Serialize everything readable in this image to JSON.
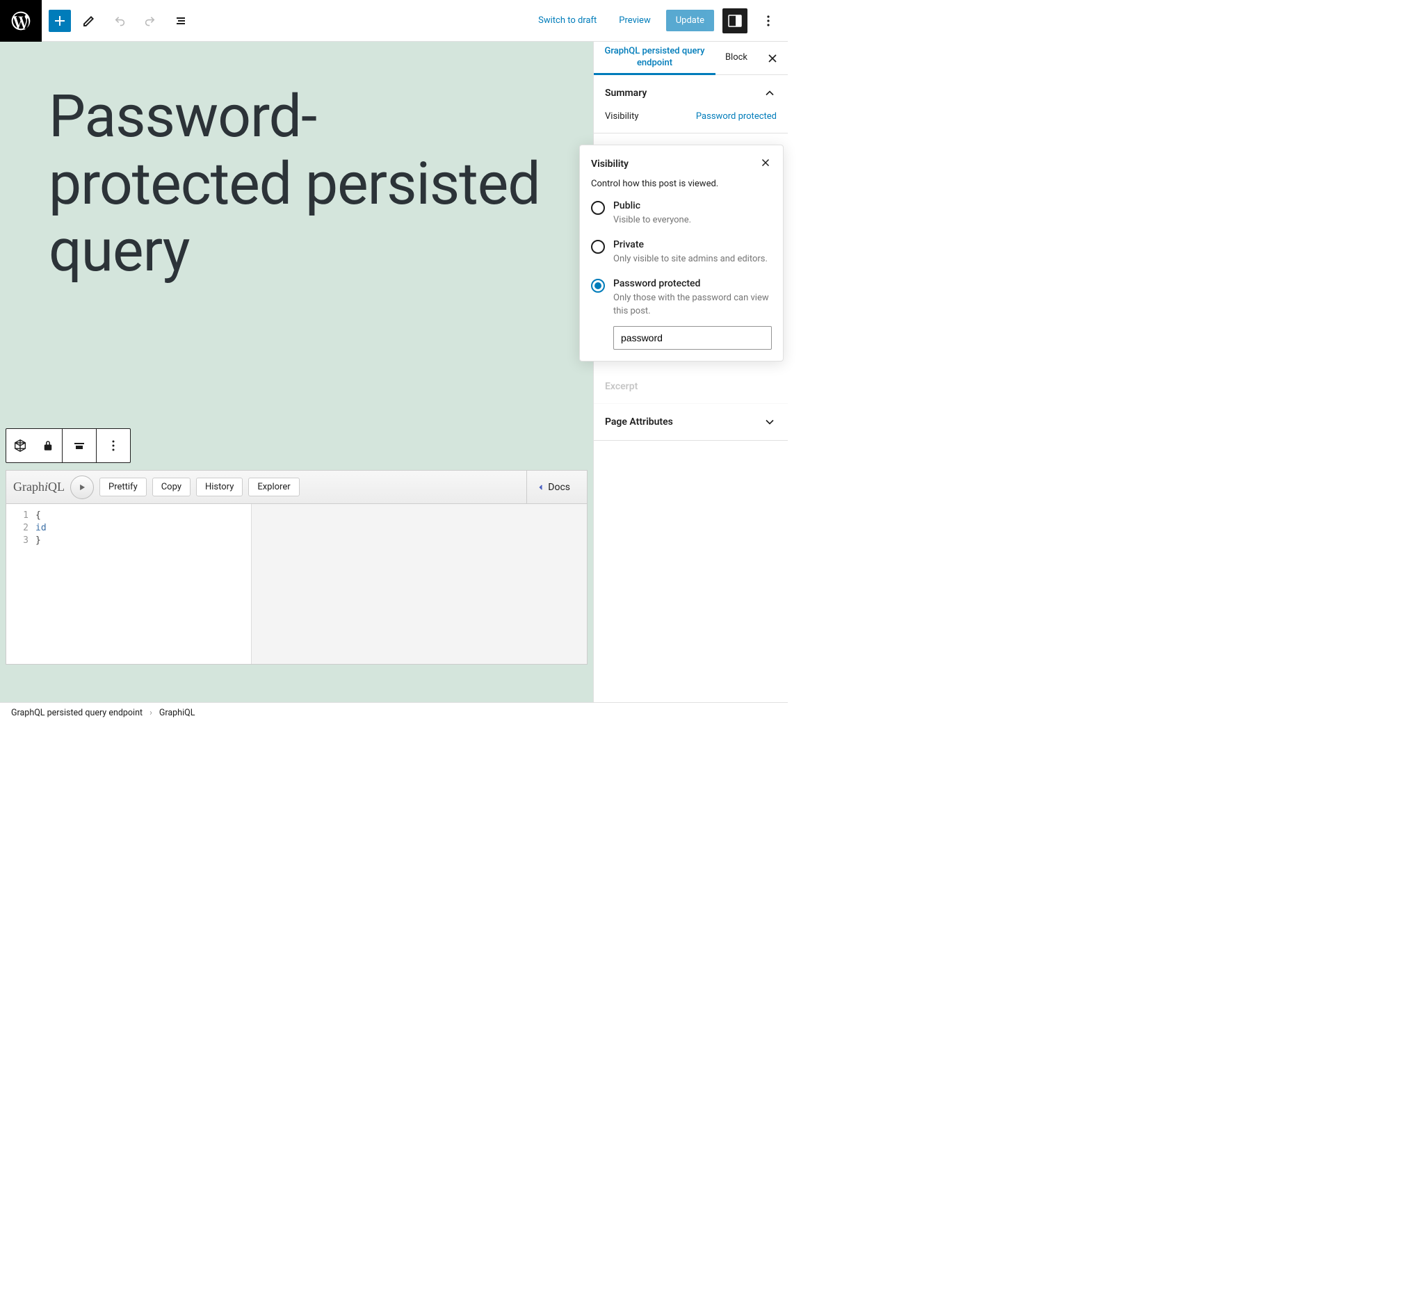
{
  "toolbar": {
    "switch_to_draft": "Switch to draft",
    "preview": "Preview",
    "update": "Update"
  },
  "post": {
    "title": "Password-protected persisted query"
  },
  "graphiql": {
    "title_prefix": "Graph",
    "title_i": "i",
    "title_suffix": "QL",
    "buttons": {
      "prettify": "Prettify",
      "copy": "Copy",
      "history": "History",
      "explorer": "Explorer",
      "docs": "Docs"
    },
    "code": {
      "line1": "{",
      "line2_indent": "  ",
      "line2_kw": "id",
      "line3": "}",
      "gutter": [
        "1",
        "2",
        "3"
      ]
    }
  },
  "sidebar": {
    "tabs": {
      "entity": "GraphQL persisted query endpoint",
      "block": "Block"
    },
    "summary": {
      "title": "Summary",
      "visibility_label": "Visibility",
      "visibility_value": "Password protected"
    },
    "excerpt_partial": "Excerpt",
    "page_attributes": "Page Attributes"
  },
  "popover": {
    "title": "Visibility",
    "desc": "Control how this post is viewed.",
    "options": [
      {
        "label": "Public",
        "desc": "Visible to everyone."
      },
      {
        "label": "Private",
        "desc": "Only visible to site admins and editors."
      },
      {
        "label": "Password protected",
        "desc": "Only those with the password can view this post."
      }
    ],
    "password_value": "password"
  },
  "footer": {
    "crumb1": "GraphQL persisted query endpoint",
    "crumb2": "GraphiQL"
  }
}
